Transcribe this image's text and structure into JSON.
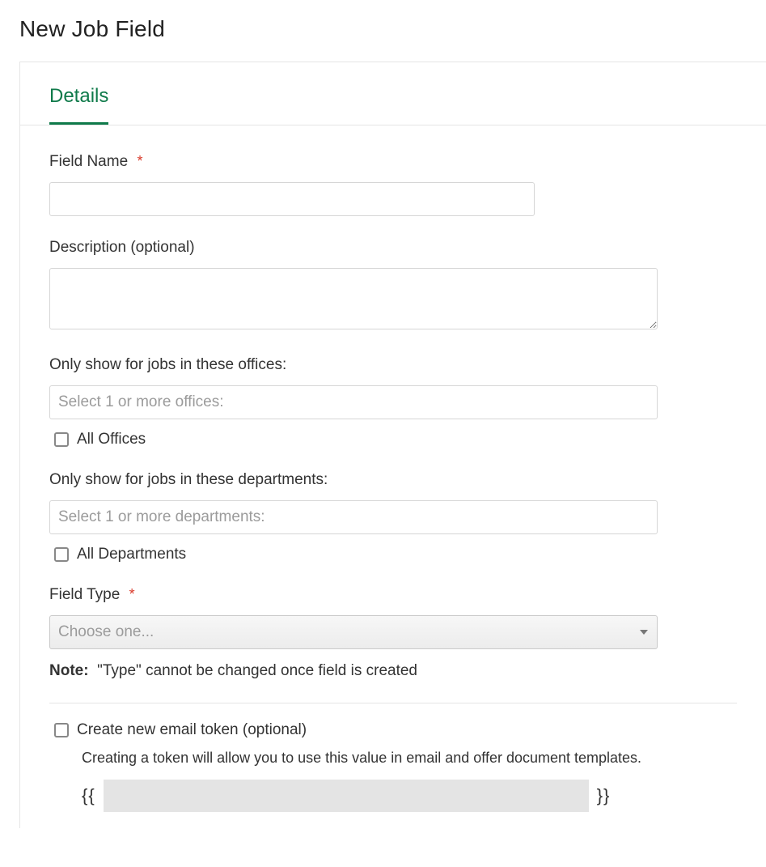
{
  "page_title": "New Job Field",
  "tabs": {
    "details": "Details"
  },
  "fields": {
    "name": {
      "label": "Field Name",
      "required_marker": "*",
      "value": ""
    },
    "description": {
      "label": "Description (optional)",
      "value": ""
    },
    "offices": {
      "label": "Only show for jobs in these offices:",
      "placeholder": "Select 1 or more offices:",
      "all_label": "All Offices",
      "all_checked": false
    },
    "departments": {
      "label": "Only show for jobs in these departments:",
      "placeholder": "Select 1 or more departments:",
      "all_label": "All Departments",
      "all_checked": false
    },
    "type": {
      "label": "Field Type",
      "required_marker": "*",
      "placeholder": "Choose one..."
    },
    "note": {
      "prefix": "Note:",
      "text": "\"Type\" cannot be changed once field is created"
    },
    "token": {
      "checkbox_label": "Create new email token (optional)",
      "checked": false,
      "help": "Creating a token will allow you to use this value in email and offer document templates.",
      "open_brace": "{{",
      "close_brace": "}}",
      "value": ""
    }
  }
}
